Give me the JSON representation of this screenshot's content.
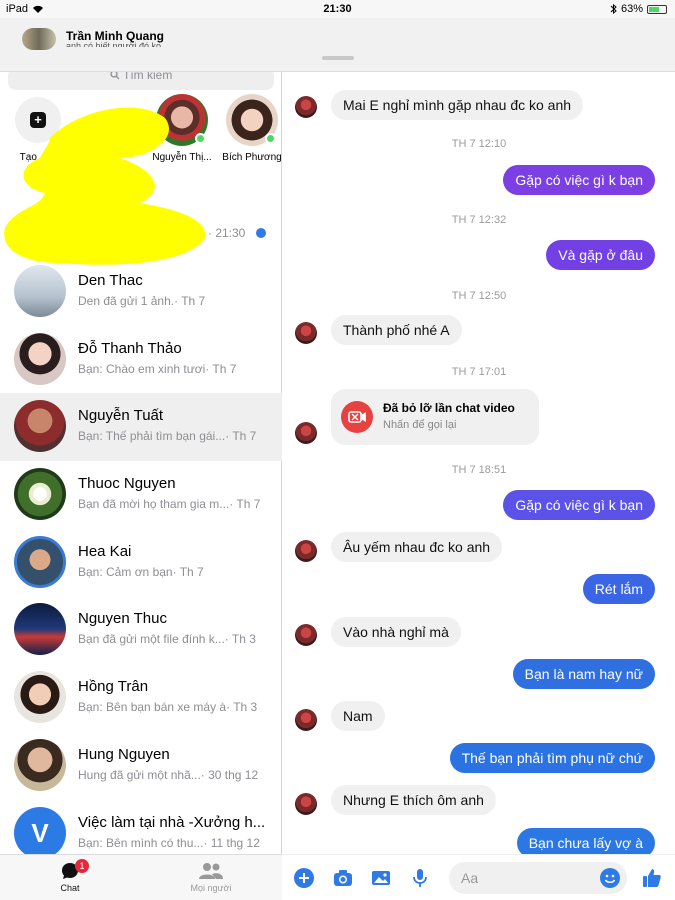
{
  "status": {
    "device": "iPad",
    "time": "21:30",
    "battery": "63%",
    "battery_level": 0.63
  },
  "account": {
    "name": "Trần Minh Quang",
    "sub": "anh có biết người đó ko"
  },
  "search": {
    "placeholder": "Tìm kiếm"
  },
  "stories": [
    {
      "label": "Tạo ... g"
    },
    {
      "label": "Nguyễn Thị..."
    },
    {
      "label": "Bích Phương"
    }
  ],
  "pinned": {
    "time": "· 21:30"
  },
  "conversations": [
    {
      "name": "Den Thac",
      "preview": "Den đã gửi 1 ảnh.",
      "time": "· Th 7"
    },
    {
      "name": "Đỗ Thanh Thảo",
      "preview": "Bạn: Chào em xinh tươi",
      "time": "· Th 7"
    },
    {
      "name": "Nguyễn Tuất",
      "preview": "Bạn: Thế phải tìm bạn gái...",
      "time": "· Th 7"
    },
    {
      "name": "Thuoc Nguyen",
      "preview": "Bạn đã mời họ tham gia m...",
      "time": "· Th 7"
    },
    {
      "name": "Hea Kai",
      "preview": "Bạn: Cảm ơn bạn",
      "time": "· Th 7"
    },
    {
      "name": "Nguyen Thuc",
      "preview": "Bạn đã gửi một file đính k...",
      "time": "· Th 3"
    },
    {
      "name": "Hồng Trân",
      "preview": "Bạn: Bên bạn bán xe máy à",
      "time": "· Th 3"
    },
    {
      "name": "Hung Nguyen",
      "preview": "Hung đã gửi một nhã...",
      "time": "· 30 thg 12"
    },
    {
      "name": "Việc làm tại nhà -Xưởng h...",
      "preview": "Bạn: Bên mình có thu...",
      "time": "· 11 thg 12",
      "letter": "V"
    }
  ],
  "tabs": {
    "chat": "Chat",
    "chat_badge": "1",
    "people": "Mọi người"
  },
  "messages": [
    {
      "dir": "in",
      "text": "Mai E nghỉ mình gặp nhau đc ko anh"
    },
    {
      "ts": "TH 7 12:10"
    },
    {
      "dir": "out",
      "text": "Gặp có việc gì k bạn"
    },
    {
      "ts": "TH 7 12:32"
    },
    {
      "dir": "out",
      "text": "Và gặp ở đâu"
    },
    {
      "ts": "TH 7 12:50"
    },
    {
      "dir": "in",
      "text": "Thành phố nhé A"
    },
    {
      "ts": "TH 7 17:01"
    },
    {
      "missed_title": "Đã bỏ lỡ lần chat video",
      "missed_sub": "Nhấn để gọi lại"
    },
    {
      "ts": "TH 7 18:51"
    },
    {
      "dir": "out",
      "text": "Gặp có việc gì k bạn"
    },
    {
      "dir": "in",
      "text": "Âu yếm nhau đc ko anh"
    },
    {
      "dir": "out",
      "text": "Rét lắm"
    },
    {
      "dir": "in",
      "text": "Vào nhà nghỉ mà"
    },
    {
      "dir": "out",
      "text": "Bạn là nam hay nữ"
    },
    {
      "dir": "in",
      "text": "Nam"
    },
    {
      "dir": "out",
      "text": "Thế bạn phải tìm phụ nữ chứ"
    },
    {
      "dir": "in",
      "text": "Nhưng E thích ôm anh"
    },
    {
      "dir": "out",
      "text": "Bạn chưa lấy vợ à"
    }
  ],
  "composer": {
    "placeholder": "Aa"
  },
  "colors": {
    "accent": "#2f7ae5",
    "outgoing_purple": "#7b3fe4",
    "outgoing_blue": "#2f6fe0",
    "incoming": "#f1f0f0"
  }
}
